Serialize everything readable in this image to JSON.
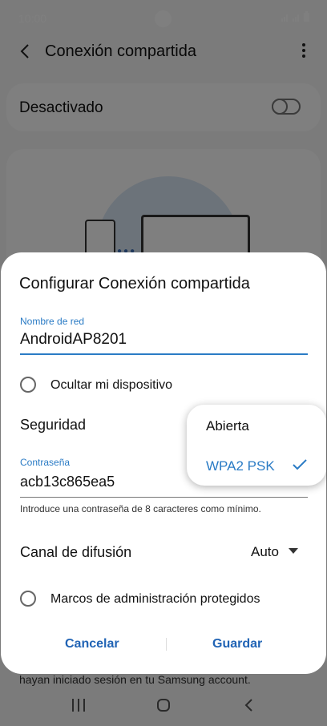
{
  "status_bar": {
    "time": "10:00"
  },
  "appbar": {
    "title": "Conexión compartida"
  },
  "toggle": {
    "label": "Desactivado"
  },
  "background": {
    "bottom_text": "hayan iniciado sesión en tu Samsung account."
  },
  "dialog": {
    "title": "Configurar Conexión compartida",
    "network_name": {
      "label": "Nombre de red",
      "value": "AndroidAP8201"
    },
    "hide_device": {
      "label": "Ocultar mi dispositivo"
    },
    "security": {
      "label": "Seguridad",
      "options": [
        "Abierta",
        "WPA2 PSK"
      ],
      "selected": "WPA2 PSK"
    },
    "password": {
      "label": "Contraseña",
      "value": "acb13c865ea5",
      "helper": "Introduce una contraseña de 8 caracteres como mínimo."
    },
    "channel": {
      "label": "Canal de difusión",
      "value": "Auto"
    },
    "protected_frames": {
      "label": "Marcos de administración protegidos"
    },
    "cancel_label": "Cancelar",
    "save_label": "Guardar"
  },
  "colors": {
    "accent": "#2a7bc5",
    "button": "#2164b5"
  }
}
